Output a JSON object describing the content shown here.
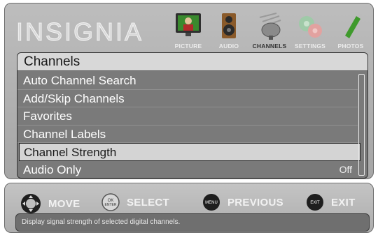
{
  "brand": {
    "logo_text": "INSIGNIA"
  },
  "tabs": [
    {
      "label": "PICTURE",
      "icon": "picture-icon",
      "active": false
    },
    {
      "label": "AUDIO",
      "icon": "speaker-icon",
      "active": false
    },
    {
      "label": "CHANNELS",
      "icon": "satellite-dish-icon",
      "active": true
    },
    {
      "label": "SETTINGS",
      "icon": "gears-icon",
      "active": false
    },
    {
      "label": "PHOTOS",
      "icon": "usb-stick-icon",
      "active": false
    }
  ],
  "panel": {
    "title": "Channels",
    "items": [
      {
        "label": "Auto Channel Search",
        "value": ""
      },
      {
        "label": "Add/Skip Channels",
        "value": ""
      },
      {
        "label": "Favorites",
        "value": ""
      },
      {
        "label": "Channel Labels",
        "value": ""
      },
      {
        "label": "Channel Strength",
        "value": "",
        "selected": true
      },
      {
        "label": "Audio Only",
        "value": "Off"
      }
    ]
  },
  "help": {
    "move": {
      "label": "MOVE",
      "icon": "dpad-icon"
    },
    "select": {
      "label": "SELECT",
      "icon": "ok-enter-button-icon",
      "icon_text": "OK ENTER"
    },
    "previous": {
      "label": "PREVIOUS",
      "icon": "menu-button-icon",
      "icon_text": "MENU"
    },
    "exit": {
      "label": "EXIT",
      "icon": "exit-button-icon",
      "icon_text": "EXIT"
    },
    "description": "Display signal strength of selected digital channels."
  },
  "colors": {
    "frame": "#b3b3b3",
    "panel_bg": "#7a7a7a",
    "selected_bg": "#d4d4d4",
    "label_light": "#ececec"
  }
}
